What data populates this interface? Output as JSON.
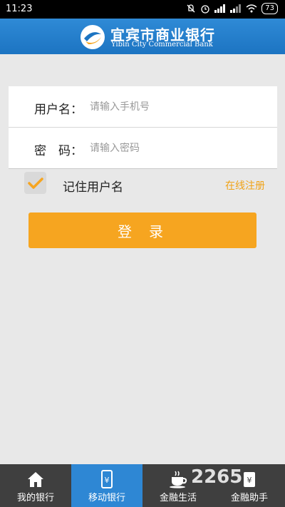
{
  "status_bar": {
    "time": "11:23",
    "battery": "73"
  },
  "header": {
    "bank_name": "宜宾市商业银行",
    "bank_name_en": "Yibin City Commercial Bank"
  },
  "form": {
    "username_label": "用户名：",
    "username_placeholder": "请输入手机号",
    "password_label": "密　码：",
    "password_placeholder": "请输入密码"
  },
  "remember": {
    "label": "记住用户名",
    "checked": true
  },
  "register_link": "在线注册",
  "login_button": "登录",
  "tabs": [
    {
      "label": "我的银行",
      "icon": "home-icon",
      "active": false
    },
    {
      "label": "移动银行",
      "icon": "mobile-banking-icon",
      "active": true
    },
    {
      "label": "金融生活",
      "icon": "coffee-cup-icon",
      "active": false
    },
    {
      "label": "金融助手",
      "icon": "wallet-icon",
      "active": false
    }
  ],
  "watermark": "2265",
  "colors": {
    "header_blue": "#1c74c2",
    "accent_orange": "#f6a520",
    "tab_active": "#2e87d4",
    "tab_bg": "#3f3f3f"
  }
}
